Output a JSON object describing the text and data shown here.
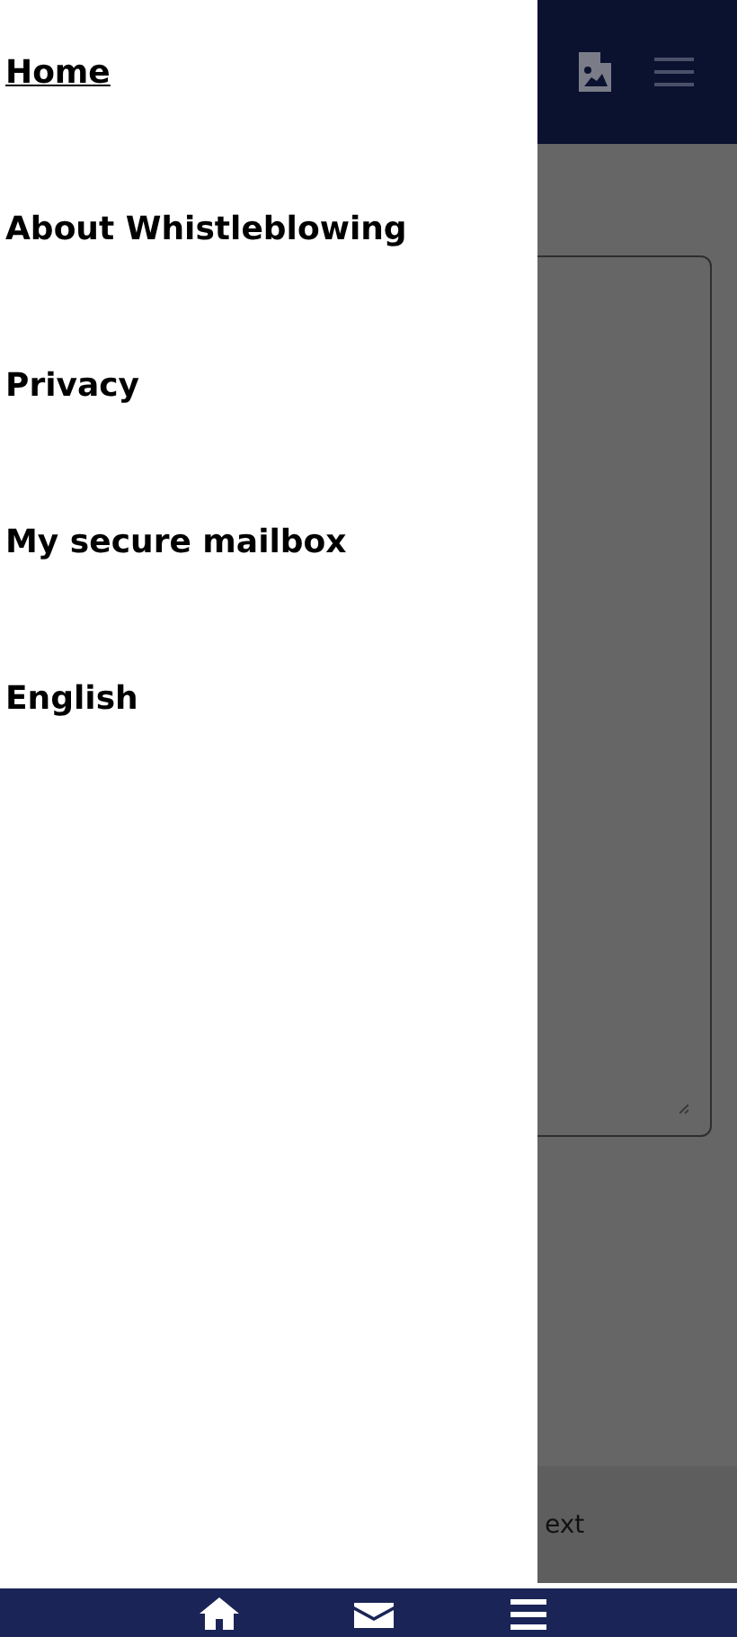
{
  "drawer": {
    "items": [
      {
        "label": "Home",
        "selected": true
      },
      {
        "label": "About Whistleblowing",
        "selected": false
      },
      {
        "label": "Privacy",
        "selected": false
      },
      {
        "label": "My secure mailbox",
        "selected": false
      },
      {
        "label": "English",
        "selected": false
      }
    ]
  },
  "form": {
    "next_button": "ext"
  },
  "bottom_nav": [
    {
      "kind": "home"
    },
    {
      "kind": "mail"
    },
    {
      "kind": "menu"
    }
  ]
}
